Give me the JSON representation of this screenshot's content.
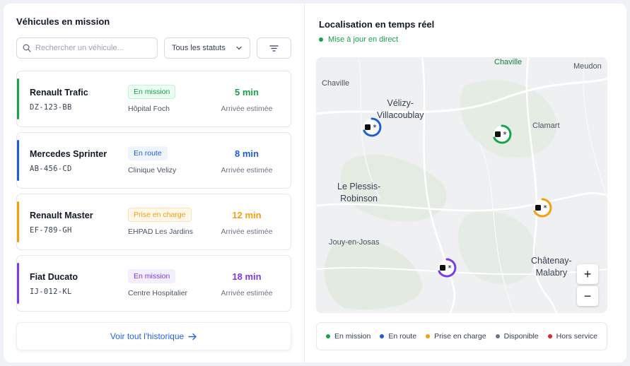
{
  "left_panel": {
    "title": "Véhicules en mission",
    "search_placeholder": "Rechercher un véhicule...",
    "status_filter": "Tous les statuts",
    "history_link": "Voir tout l'historique"
  },
  "vehicles": [
    {
      "name": "Renault Trafic",
      "plate": "DZ-123-BB",
      "status": "En mission",
      "destination": "Hôpital Foch",
      "eta": "5 min",
      "eta_label": "Arrivée estimée",
      "color": "#16a34a",
      "badge_bg": "#ecfdf3",
      "badge_border": "#bbf7d0"
    },
    {
      "name": "Mercedes Sprinter",
      "plate": "AB-456-CD",
      "status": "En route",
      "destination": "Clinique Velizy",
      "eta": "8 min",
      "eta_label": "Arrivée estimée",
      "color": "#1d5fd6",
      "badge_bg": "#eff5ff",
      "badge_border": "#eff5ff"
    },
    {
      "name": "Renault Master",
      "plate": "EF-789-GH",
      "status": "Prise en charge",
      "destination": "EHPAD Les Jardins",
      "eta": "12 min",
      "eta_label": "Arrivée estimée",
      "color": "#f59e0b",
      "badge_bg": "#fff7ea",
      "badge_border": "#fde1b0"
    },
    {
      "name": "Fiat Ducato",
      "plate": "IJ-012-KL",
      "status": "En mission",
      "destination": "Centre Hospitalier",
      "eta": "18 min",
      "eta_label": "Arrivée estimée",
      "color": "#7c3aed",
      "badge_bg": "#f3efff",
      "badge_border": "#f3efff"
    }
  ],
  "right_panel": {
    "title": "Localisation en temps réel",
    "live_text": "Mise à jour en direct",
    "zoom_in": "+",
    "zoom_out": "−"
  },
  "map_places": {
    "chaville_top": "Chaville",
    "meudon": "Meudon",
    "chaville": "Chaville",
    "velizy": "Vélizy-\nVillacoublay",
    "clamart": "Clamart",
    "plessis": "Le Plessis-\nRobinson",
    "jouy": "Jouy-en-Josas",
    "chatenay": "Châtenay-\nMalabry"
  },
  "legend": [
    {
      "label": "En mission",
      "color": "#16a34a"
    },
    {
      "label": "En route",
      "color": "#1d5fd6"
    },
    {
      "label": "Prise en charge",
      "color": "#f59e0b"
    },
    {
      "label": "Disponible",
      "color": "#64748b"
    },
    {
      "label": "Hors service",
      "color": "#dc2626"
    }
  ],
  "icons": {
    "search": "search-icon",
    "chevron": "chevron-down-icon",
    "filter": "filter-icon",
    "arrow": "arrow-right-icon",
    "vehicle": "vehicle-icon"
  }
}
